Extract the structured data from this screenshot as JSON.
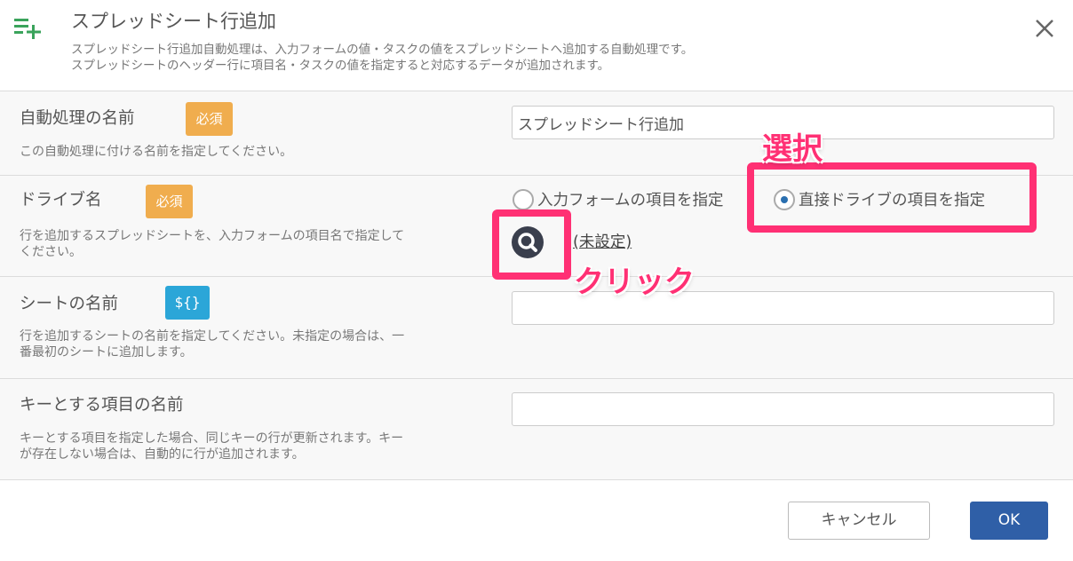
{
  "dialog": {
    "title": "スプレッドシート行追加",
    "description_line1": "スプレッドシート行追加自動処理は、入力フォームの値・タスクの値をスプレッドシートへ追加する自動処理です。",
    "description_line2": "スプレッドシートのヘッダー行に項目名・タスクの値を指定すると対応するデータが追加されます。",
    "header_icon": "playlist-add-icon",
    "close_icon": "close-icon"
  },
  "fields": {
    "name": {
      "label": "自動処理の名前",
      "badge": "必須",
      "help": "この自動処理に付ける名前を指定してください。",
      "value": "スプレッドシート行追加"
    },
    "drive": {
      "label": "ドライブ名",
      "badge": "必須",
      "help_line1": "行を追加するスプレッドシートを、入力フォームの項目名で指定して",
      "help_line2": "ください。",
      "radio_form": "入力フォームの項目を指定",
      "radio_direct": "直接ドライブの項目を指定",
      "selected": "direct",
      "unset_text": "(未設定)",
      "search_icon": "search-icon"
    },
    "sheet": {
      "label": "シートの名前",
      "badge": "${}",
      "help_line1": "行を追加するシートの名前を指定してください。未指定の場合は、一",
      "help_line2": "番最初のシートに追加します。",
      "value": ""
    },
    "key": {
      "label": "キーとする項目の名前",
      "help_line1": "キーとする項目を指定した場合、同じキーの行が更新されます。キー",
      "help_line2": "が存在しない場合は、自動的に行が追加されます。",
      "value": ""
    }
  },
  "annotations": {
    "select": "選択",
    "click": "クリック",
    "color": "#ff3074"
  },
  "footer": {
    "cancel": "キャンセル",
    "ok": "OK"
  },
  "colors": {
    "required_badge": "#f0ad4e",
    "var_badge": "#2ba6d8",
    "ok_button": "#2f5fa7",
    "header_icon": "#3aa35b"
  }
}
